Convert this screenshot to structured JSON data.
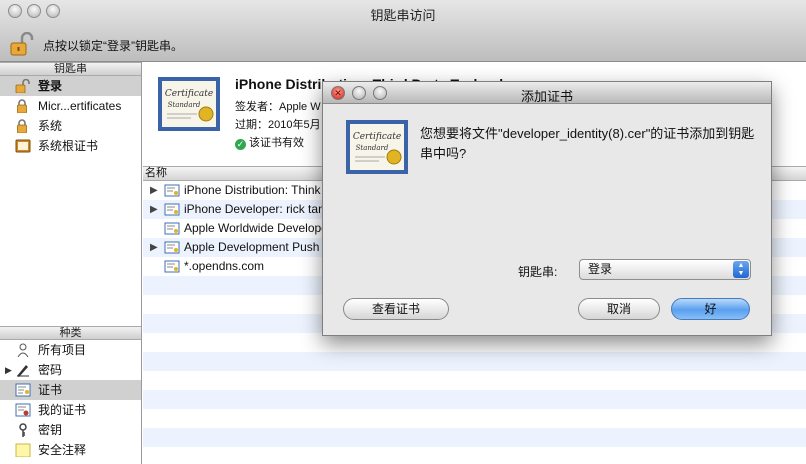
{
  "window": {
    "title": "钥匙串访问",
    "lock_hint": "点按以锁定“登录”钥匙串。"
  },
  "sidebar": {
    "keychains_header": "钥匙串",
    "keychains": [
      {
        "label": "登录",
        "icon": "unlocked-padlock-icon",
        "selected": true
      },
      {
        "label": "Micr...ertificates",
        "icon": "padlock-icon"
      },
      {
        "label": "系统",
        "icon": "padlock-icon"
      },
      {
        "label": "系统根证书",
        "icon": "cabinet-icon"
      }
    ],
    "category_header": "种类",
    "categories": [
      {
        "label": "所有项目",
        "icon": "people-icon"
      },
      {
        "label": "密码",
        "icon": "pen-icon",
        "expandable": true
      },
      {
        "label": "证书",
        "icon": "certificate-icon",
        "selected": true
      },
      {
        "label": "我的证书",
        "icon": "my-certificate-icon"
      },
      {
        "label": "密钥",
        "icon": "key-icon"
      },
      {
        "label": "安全注释",
        "icon": "note-icon"
      }
    ]
  },
  "info": {
    "title": "iPhone Distribution: Third Party Technol",
    "issuer": "签发者：Apple W",
    "expires": "过期：2010年5月",
    "valid": "该证书有效"
  },
  "list": {
    "column_name": "名称",
    "rows": [
      {
        "name": "iPhone Distribution: Think",
        "expandable": true
      },
      {
        "name": "iPhone Developer: rick tan",
        "expandable": true
      },
      {
        "name": "Apple Worldwide Develope",
        "expandable": false
      },
      {
        "name": "Apple Development Push",
        "expandable": true
      },
      {
        "name": "*.opendns.com",
        "expandable": false
      }
    ]
  },
  "dialog": {
    "title": "添加证书",
    "message": "您想要将文件\"developer_identity(8).cer\"的证书添加到钥匙串中吗?",
    "keychain_label": "钥匙串:",
    "keychain_value": "登录",
    "view_button": "查看证书",
    "cancel_button": "取消",
    "ok_button": "好"
  },
  "colors": {
    "selection": "#d0d0d0",
    "stripe": "#edf3fe",
    "default_button": "#5aa0ef",
    "close_button": "#d0221a"
  }
}
